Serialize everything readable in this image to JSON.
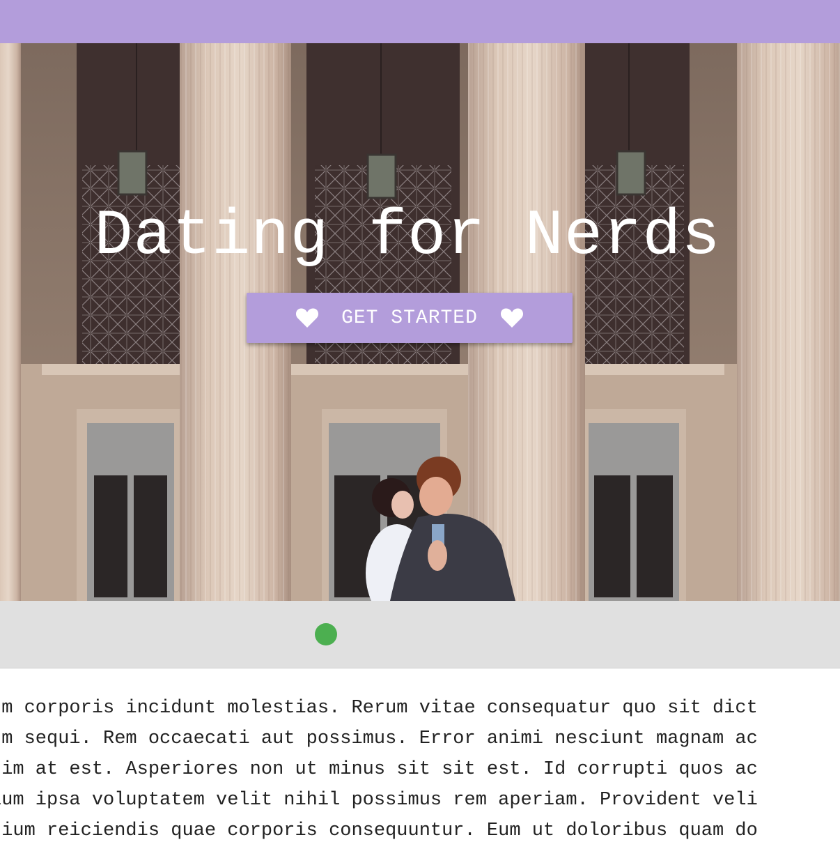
{
  "colors": {
    "accent": "#b39ddb",
    "status_dot": "#4caf50",
    "strip": "#e0e0e0"
  },
  "hero": {
    "title": "Dating for Nerds",
    "cta_label": "GET STARTED",
    "cta_icon": "heart-icon"
  },
  "status": {
    "indicator": "online-dot"
  },
  "body": {
    "lines": [
      "um corporis incidunt molestias. Rerum vitae consequatur quo sit dict",
      "um sequi. Rem occaecati aut possimus. Error animi nesciunt magnam ac",
      "nim at est. Asperiores non ut minus sit sit est. Id corrupti quos ac",
      "ium ipsa voluptatem velit nihil possimus rem aperiam. Provident veli",
      "tium reiciendis quae corporis consequuntur. Eum ut doloribus quam do"
    ]
  }
}
